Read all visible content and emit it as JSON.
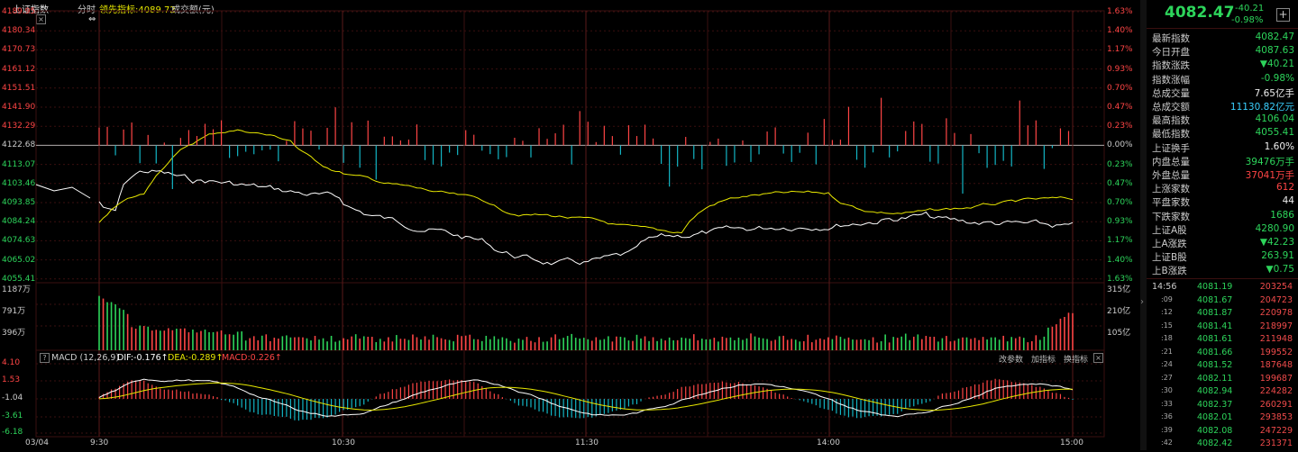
{
  "header": {
    "title": "上证指数",
    "mode": "分时",
    "lead_label": "领先指标:",
    "lead_value": "4089.72",
    "volume_unit": "成交额(元)"
  },
  "price_axis": {
    "left": [
      "4189.95",
      "4180.34",
      "4170.73",
      "4161.12",
      "4151.51",
      "4141.90",
      "4132.29",
      "4122.68",
      "4113.07",
      "4103.46",
      "4093.85",
      "4084.24",
      "4074.63",
      "4065.02",
      "4055.41"
    ],
    "right": [
      "1.63%",
      "1.40%",
      "1.17%",
      "0.93%",
      "0.70%",
      "0.47%",
      "0.23%",
      "0.00%",
      "0.23%",
      "0.47%",
      "0.70%",
      "0.93%",
      "1.17%",
      "1.40%",
      "1.63%"
    ]
  },
  "volume_axis": {
    "left": [
      "1187万",
      "791万",
      "396万"
    ],
    "right": [
      "315亿",
      "210亿",
      "105亿"
    ]
  },
  "macd": {
    "title": "MACD (12,26,9)",
    "dif": "DIF:-0.176↑",
    "dea": "DEA:-0.289↑",
    "macd": "MACD:0.226↑",
    "axis": [
      "4.10",
      "1.53",
      "-1.04",
      "-3.61",
      "-6.18"
    ],
    "buttons": [
      "改参数",
      "加指标",
      "换指标"
    ],
    "help": "?",
    "close": "×"
  },
  "time_axis": [
    "03/04",
    "9:30",
    "10:30",
    "11:30",
    "14:00",
    "15:00"
  ],
  "chart_close": "×",
  "cursor_icon": "⇔",
  "colors": {
    "up": "#ff4545",
    "down": "#2dd55b",
    "grid": "#3a0f0f",
    "line_white": "#ffffff",
    "line_yellow": "#e8e800",
    "cyan": "#13b5c4"
  },
  "side": {
    "price": "4082.47",
    "change": "-40.21",
    "change_pct": "-0.98%",
    "plus": "+",
    "stats": [
      {
        "k": "最新指数",
        "v": "4082.47",
        "c": "grn"
      },
      {
        "k": "今日开盘",
        "v": "4087.63",
        "c": "grn"
      },
      {
        "k": "指数涨跌",
        "v": "▼40.21",
        "c": "grn"
      },
      {
        "k": "指数涨幅",
        "v": "-0.98%",
        "c": "grn"
      },
      {
        "k": "总成交量",
        "v": "7.65亿手",
        "c": "white"
      },
      {
        "k": "总成交额",
        "v": "11130.82亿元",
        "c": "cyanv"
      },
      {
        "k": "最高指数",
        "v": "4106.04",
        "c": "grn"
      },
      {
        "k": "最低指数",
        "v": "4055.41",
        "c": "grn"
      },
      {
        "k": "上证换手",
        "v": "1.60%",
        "c": "white"
      },
      {
        "k": "内盘总量",
        "v": "39476万手",
        "c": "grn"
      },
      {
        "k": "外盘总量",
        "v": "37041万手",
        "c": "red"
      },
      {
        "k": "上涨家数",
        "v": "612",
        "c": "red"
      },
      {
        "k": "平盘家数",
        "v": "44",
        "c": "white"
      },
      {
        "k": "下跌家数",
        "v": "1686",
        "c": "grn"
      },
      {
        "k": "上证A股",
        "v": "4280.90",
        "c": "grn"
      },
      {
        "k": "上A涨跌",
        "v": "▼42.23",
        "c": "grn"
      },
      {
        "k": "上证B股",
        "v": "263.91",
        "c": "grn"
      },
      {
        "k": "上B涨跌",
        "v": "▼0.75",
        "c": "grn"
      }
    ],
    "ticks": [
      {
        "t": "14:56",
        "p": "4081.19",
        "v": "203254"
      },
      {
        "t": ":09",
        "p": "4081.67",
        "v": "204723"
      },
      {
        "t": ":12",
        "p": "4081.87",
        "v": "220978"
      },
      {
        "t": ":15",
        "p": "4081.41",
        "v": "218997"
      },
      {
        "t": ":18",
        "p": "4081.61",
        "v": "211948"
      },
      {
        "t": ":21",
        "p": "4081.66",
        "v": "199552"
      },
      {
        "t": ":24",
        "p": "4081.52",
        "v": "187648"
      },
      {
        "t": ":27",
        "p": "4082.11",
        "v": "199687"
      },
      {
        "t": ":30",
        "p": "4082.94",
        "v": "224282"
      },
      {
        "t": ":33",
        "p": "4082.37",
        "v": "260291"
      },
      {
        "t": ":36",
        "p": "4082.01",
        "v": "293853"
      },
      {
        "t": ":39",
        "p": "4082.08",
        "v": "247229"
      },
      {
        "t": ":42",
        "p": "4082.42",
        "v": "231371"
      }
    ]
  }
}
